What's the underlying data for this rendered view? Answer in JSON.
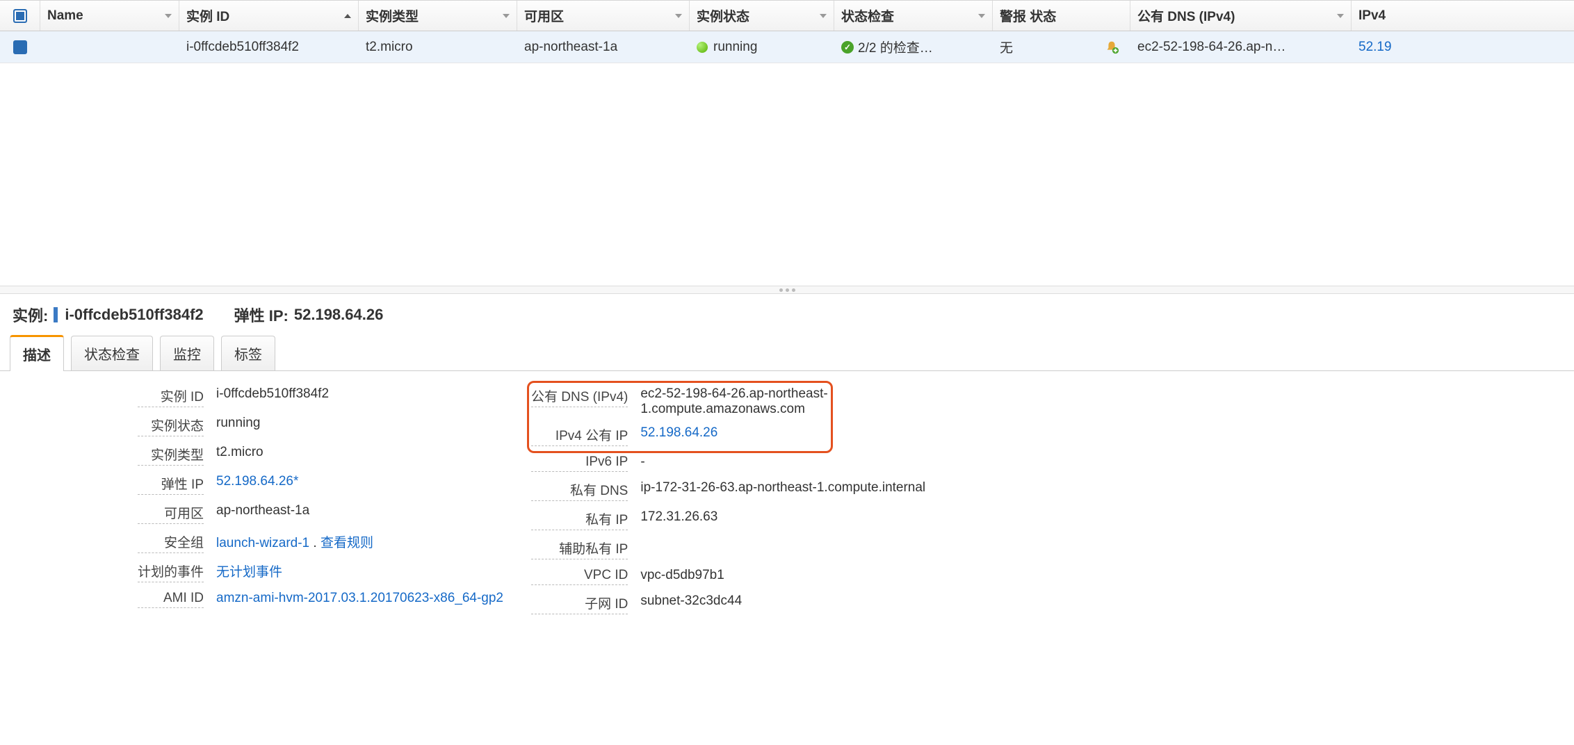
{
  "table": {
    "headers": {
      "name": "Name",
      "instance_id": "实例 ID",
      "instance_type": "实例类型",
      "az": "可用区",
      "state": "实例状态",
      "status_check": "状态检查",
      "alarm_status": "警报 状态",
      "public_dns": "公有 DNS (IPv4)",
      "ipv4": "IPv4"
    },
    "row": {
      "name": "",
      "instance_id": "i-0ffcdeb510ff384f2",
      "instance_type": "t2.micro",
      "az": "ap-northeast-1a",
      "state": "running",
      "status_check": "2/2 的检查…",
      "alarm_status": "无",
      "public_dns": "ec2-52-198-64-26.ap-n…",
      "ipv4": "52.19"
    }
  },
  "detail_header": {
    "label": "实例:",
    "instance_id": "i-0ffcdeb510ff384f2",
    "elastic_ip_label": "弹性 IP:",
    "elastic_ip": "52.198.64.26"
  },
  "tabs": {
    "description": "描述",
    "status_check": "状态检查",
    "monitoring": "监控",
    "tags": "标签"
  },
  "left_kv": {
    "instance_id_label": "实例 ID",
    "instance_id": "i-0ffcdeb510ff384f2",
    "instance_state_label": "实例状态",
    "instance_state": "running",
    "instance_type_label": "实例类型",
    "instance_type": "t2.micro",
    "elastic_ip_label": "弹性 IP",
    "elastic_ip": "52.198.64.26*",
    "az_label": "可用区",
    "az": "ap-northeast-1a",
    "sg_label": "安全组",
    "sg_value": "launch-wizard-1",
    "sg_sep": ".",
    "sg_view_rules": "查看规则",
    "schedevents_label": "计划的事件",
    "schedevents": "无计划事件",
    "ami_id_label": "AMI ID",
    "ami_id": "amzn-ami-hvm-2017.03.1.20170623-x86_64-gp2"
  },
  "right_kv": {
    "public_dns_label": "公有 DNS (IPv4)",
    "public_dns": "ec2-52-198-64-26.ap-northeast-1.compute.amazonaws.com",
    "public_ip_label": "IPv4 公有 IP",
    "public_ip": "52.198.64.26",
    "ipv6_label": "IPv6 IP",
    "ipv6": "-",
    "private_dns_label": "私有 DNS",
    "private_dns": "ip-172-31-26-63.ap-northeast-1.compute.internal",
    "private_ip_label": "私有 IP",
    "private_ip": "172.31.26.63",
    "secondary_private_ip_label": "辅助私有 IP",
    "secondary_private_ip": "",
    "vpc_id_label": "VPC ID",
    "vpc_id": "vpc-d5db97b1",
    "subnet_id_label": "子网 ID",
    "subnet_id": "subnet-32c3dc44"
  }
}
